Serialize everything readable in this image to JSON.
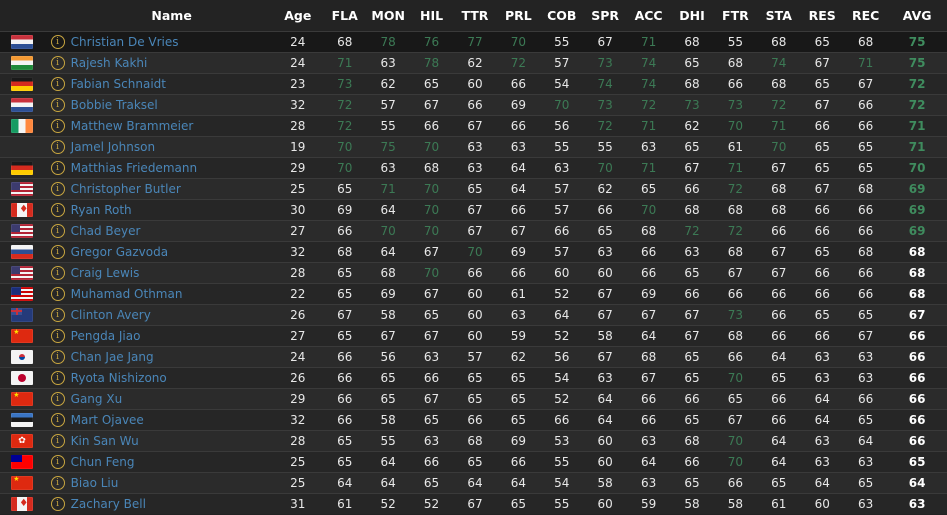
{
  "columns": [
    "",
    "",
    "Name",
    "Age",
    "FLA",
    "MON",
    "HIL",
    "TTR",
    "PRL",
    "COB",
    "SPR",
    "ACC",
    "DHI",
    "FTR",
    "STA",
    "RES",
    "REC",
    "AVG"
  ],
  "highlight_threshold": 70,
  "avg_highlight_threshold": 69,
  "colors": {
    "highlight": "#3c7a55",
    "name_link": "#4a86b8",
    "info_icon": "#c8a640"
  },
  "rows": [
    {
      "flag": "nl",
      "name": "Christian De Vries",
      "age": 24,
      "stats": [
        68,
        78,
        76,
        77,
        70,
        55,
        67,
        71,
        68,
        55,
        68,
        65,
        68
      ],
      "avg": 75
    },
    {
      "flag": "in",
      "name": "Rajesh Kakhi",
      "age": 24,
      "stats": [
        71,
        63,
        78,
        62,
        72,
        57,
        73,
        74,
        65,
        68,
        74,
        67,
        71
      ],
      "avg": 75
    },
    {
      "flag": "de",
      "name": "Fabian Schnaidt",
      "age": 23,
      "stats": [
        73,
        62,
        65,
        60,
        66,
        54,
        74,
        74,
        68,
        66,
        68,
        65,
        67
      ],
      "avg": 72
    },
    {
      "flag": "nl",
      "name": "Bobbie Traksel",
      "age": 32,
      "stats": [
        72,
        57,
        67,
        66,
        69,
        70,
        73,
        72,
        73,
        73,
        72,
        67,
        66
      ],
      "avg": 72
    },
    {
      "flag": "ie",
      "name": "Matthew Brammeier",
      "age": 28,
      "stats": [
        72,
        55,
        66,
        67,
        66,
        56,
        72,
        71,
        62,
        70,
        71,
        66,
        66
      ],
      "avg": 71
    },
    {
      "flag": "none",
      "name": "Jamel Johnson",
      "age": 19,
      "stats": [
        70,
        75,
        70,
        63,
        63,
        55,
        55,
        63,
        65,
        61,
        70,
        65,
        65
      ],
      "avg": 71
    },
    {
      "flag": "de",
      "name": "Matthias Friedemann",
      "age": 29,
      "stats": [
        70,
        63,
        68,
        63,
        64,
        63,
        70,
        71,
        67,
        71,
        67,
        65,
        65
      ],
      "avg": 70
    },
    {
      "flag": "us",
      "name": "Christopher Butler",
      "age": 25,
      "stats": [
        65,
        71,
        70,
        65,
        64,
        57,
        62,
        65,
        66,
        72,
        68,
        67,
        68
      ],
      "avg": 69
    },
    {
      "flag": "ca",
      "name": "Ryan Roth",
      "age": 30,
      "stats": [
        69,
        64,
        70,
        67,
        66,
        57,
        66,
        70,
        68,
        68,
        68,
        66,
        66
      ],
      "avg": 69
    },
    {
      "flag": "us",
      "name": "Chad Beyer",
      "age": 27,
      "stats": [
        66,
        70,
        70,
        67,
        67,
        66,
        65,
        68,
        72,
        72,
        66,
        66,
        66
      ],
      "avg": 69
    },
    {
      "flag": "si",
      "name": "Gregor Gazvoda",
      "age": 32,
      "stats": [
        68,
        64,
        67,
        70,
        69,
        57,
        63,
        66,
        63,
        68,
        67,
        65,
        68
      ],
      "avg": 68
    },
    {
      "flag": "us",
      "name": "Craig Lewis",
      "age": 28,
      "stats": [
        65,
        68,
        70,
        66,
        66,
        60,
        60,
        66,
        65,
        67,
        67,
        66,
        66
      ],
      "avg": 68
    },
    {
      "flag": "my",
      "name": "Muhamad Othman",
      "age": 22,
      "stats": [
        65,
        69,
        67,
        60,
        61,
        52,
        67,
        69,
        66,
        66,
        66,
        66,
        66
      ],
      "avg": 68
    },
    {
      "flag": "nz",
      "name": "Clinton Avery",
      "age": 26,
      "stats": [
        67,
        58,
        65,
        60,
        63,
        64,
        67,
        67,
        67,
        73,
        66,
        65,
        65
      ],
      "avg": 67
    },
    {
      "flag": "cn",
      "name": "Pengda Jiao",
      "age": 27,
      "stats": [
        65,
        67,
        67,
        60,
        59,
        52,
        58,
        64,
        67,
        68,
        66,
        66,
        67
      ],
      "avg": 66
    },
    {
      "flag": "kr",
      "name": "Chan Jae Jang",
      "age": 24,
      "stats": [
        66,
        56,
        63,
        57,
        62,
        56,
        67,
        68,
        65,
        66,
        64,
        63,
        63
      ],
      "avg": 66
    },
    {
      "flag": "jp",
      "name": "Ryota Nishizono",
      "age": 26,
      "stats": [
        66,
        65,
        66,
        65,
        65,
        54,
        63,
        67,
        65,
        70,
        65,
        63,
        63
      ],
      "avg": 66
    },
    {
      "flag": "cn",
      "name": "Gang Xu",
      "age": 29,
      "stats": [
        66,
        65,
        67,
        65,
        65,
        52,
        64,
        66,
        66,
        65,
        66,
        64,
        66
      ],
      "avg": 66
    },
    {
      "flag": "ee",
      "name": "Mart Ojavee",
      "age": 32,
      "stats": [
        66,
        58,
        65,
        66,
        65,
        66,
        64,
        66,
        65,
        67,
        66,
        64,
        65
      ],
      "avg": 66
    },
    {
      "flag": "hk",
      "name": "Kin San Wu",
      "age": 28,
      "stats": [
        65,
        55,
        63,
        68,
        69,
        53,
        60,
        63,
        68,
        70,
        64,
        63,
        64
      ],
      "avg": 66
    },
    {
      "flag": "tw",
      "name": "Chun Feng",
      "age": 25,
      "stats": [
        65,
        64,
        66,
        65,
        66,
        55,
        60,
        64,
        66,
        70,
        64,
        63,
        63
      ],
      "avg": 65
    },
    {
      "flag": "cn",
      "name": "Biao Liu",
      "age": 25,
      "stats": [
        64,
        64,
        65,
        64,
        64,
        54,
        58,
        63,
        65,
        66,
        65,
        64,
        65
      ],
      "avg": 64
    },
    {
      "flag": "ca",
      "name": "Zachary Bell",
      "age": 31,
      "stats": [
        61,
        52,
        52,
        67,
        65,
        55,
        60,
        59,
        58,
        58,
        61,
        60,
        63
      ],
      "avg": 63
    }
  ],
  "selected_row": 0
}
